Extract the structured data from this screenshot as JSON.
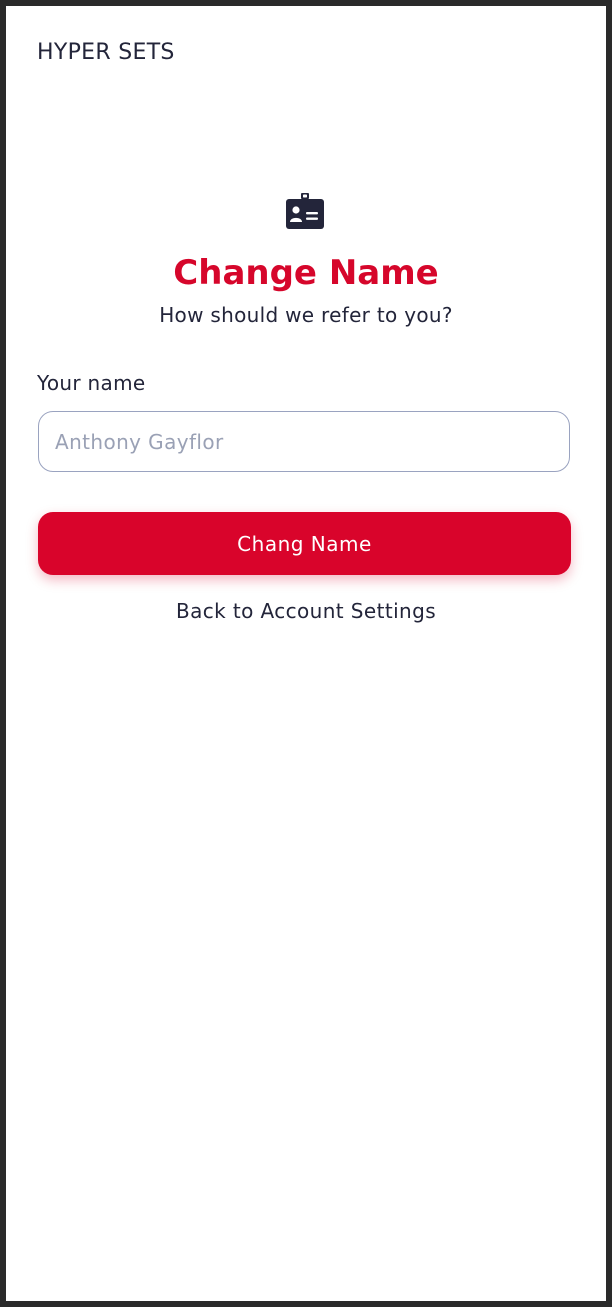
{
  "app": {
    "brand": "HYPER SETS"
  },
  "header": {
    "icon": "id-card-icon",
    "title": "Change Name",
    "subtitle": "How should we refer to you?"
  },
  "form": {
    "name_label": "Your name",
    "name_value": "",
    "name_placeholder": "Anthony Gayflor",
    "submit_label": "Chang Name"
  },
  "navigation": {
    "back_label": "Back to Account Settings"
  },
  "colors": {
    "accent": "#d9042b",
    "text": "#23253a",
    "input_border": "#9aa3c0",
    "placeholder": "#9aa1b5",
    "icon": "#23253a"
  }
}
